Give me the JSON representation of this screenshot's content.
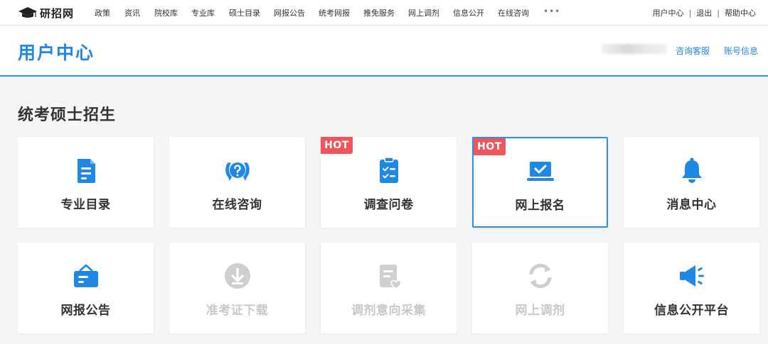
{
  "site": {
    "logo_text": "研招网"
  },
  "topnav": {
    "items": [
      "政策",
      "资讯",
      "院校库",
      "专业库",
      "硕士目录",
      "网报公告",
      "统考网报",
      "推免服务",
      "网上调剂",
      "信息公开",
      "在线咨询"
    ],
    "more": "•••",
    "right": {
      "user_center": "用户中心",
      "logout": "退出",
      "help": "帮助中心",
      "separator": "|"
    }
  },
  "header": {
    "title": "用户中心",
    "links": {
      "service": "咨询客服",
      "account": "账号信息"
    }
  },
  "section": {
    "title": "统考硕士招生"
  },
  "cards": [
    {
      "label": "专业目录",
      "icon": "document-list-icon",
      "hot": "",
      "state": "active"
    },
    {
      "label": "在线咨询",
      "icon": "chat-question-icon",
      "hot": "",
      "state": "active"
    },
    {
      "label": "调查问卷",
      "icon": "clipboard-check-icon",
      "hot": "HOT",
      "state": "active"
    },
    {
      "label": "网上报名",
      "icon": "laptop-check-icon",
      "hot": "HOT",
      "state": "selected"
    },
    {
      "label": "消息中心",
      "icon": "bell-icon",
      "hot": "",
      "state": "active"
    },
    {
      "label": "网报公告",
      "icon": "bulletin-box-icon",
      "hot": "",
      "state": "active"
    },
    {
      "label": "准考证下载",
      "icon": "download-circle-icon",
      "hot": "",
      "state": "disabled"
    },
    {
      "label": "调剂意向采集",
      "icon": "document-heart-icon",
      "hot": "",
      "state": "disabled"
    },
    {
      "label": "网上调剂",
      "icon": "refresh-icon",
      "hot": "",
      "state": "disabled"
    },
    {
      "label": "信息公开平台",
      "icon": "megaphone-icon",
      "hot": "",
      "state": "active"
    }
  ],
  "colors": {
    "accent": "#1f88e5",
    "hot": "#f2545b",
    "disabled": "#c8c8c8",
    "text": "#333333"
  }
}
